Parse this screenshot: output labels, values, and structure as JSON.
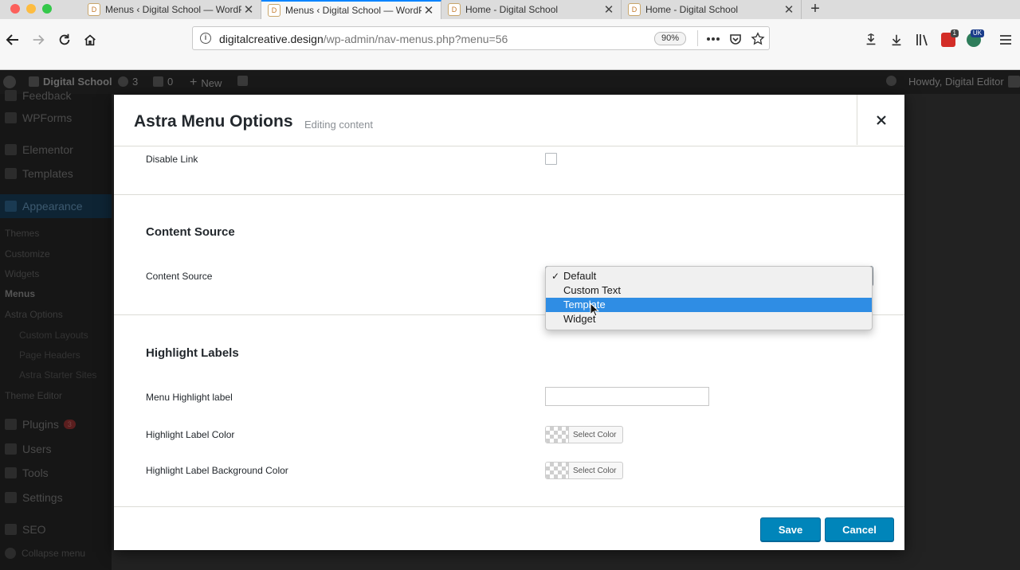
{
  "browser": {
    "tabs": [
      {
        "title": "Menus ‹ Digital School — WordPress"
      },
      {
        "title": "Menus ‹ Digital School — WordPress"
      },
      {
        "title": "Home - Digital School"
      },
      {
        "title": "Home - Digital School"
      }
    ],
    "url_domain": "digitalcreative.design",
    "url_path": "/wp-admin/nav-menus.php?menu=56",
    "zoom": "90%",
    "badge_count": "1",
    "lang_badge": "UK"
  },
  "adminbar": {
    "site_name": "Digital School",
    "updates": "3",
    "comments": "0",
    "new_label": "New",
    "howdy": "Howdy, Digital Editor"
  },
  "sidebar": {
    "feedback": "Feedback",
    "wpforms": "WPForms",
    "elementor": "Elementor",
    "templates": "Templates",
    "appearance": "Appearance",
    "themes": "Themes",
    "customize": "Customize",
    "widgets": "Widgets",
    "menus": "Menus",
    "astra_options": "Astra Options",
    "custom_layouts": "Custom Layouts",
    "page_headers": "Page Headers",
    "astra_starter_sites": "Astra Starter Sites",
    "theme_editor": "Theme Editor",
    "plugins": "Plugins",
    "plugins_count": "3",
    "users": "Users",
    "tools": "Tools",
    "settings": "Settings",
    "seo": "SEO",
    "collapse": "Collapse menu"
  },
  "modal": {
    "title": "Astra Menu Options",
    "subtitle": "Editing content",
    "disable_link_label": "Disable Link",
    "content_source_heading": "Content Source",
    "content_source_label": "Content Source",
    "content_source_options": [
      "Default",
      "Custom Text",
      "Template",
      "Widget"
    ],
    "content_source_checked": "Default",
    "content_source_highlighted": "Template",
    "highlight_heading": "Highlight Labels",
    "menu_highlight_label": "Menu Highlight label",
    "menu_highlight_value": "",
    "highlight_color_label": "Highlight Label Color",
    "highlight_bg_color_label": "Highlight Label Background Color",
    "select_color": "Select Color",
    "save": "Save",
    "cancel": "Cancel"
  },
  "colors": {
    "wp_primary": "#0085ba",
    "dropdown_highlight": "#2f8de4",
    "tab_active_accent": "#0a84ff"
  }
}
